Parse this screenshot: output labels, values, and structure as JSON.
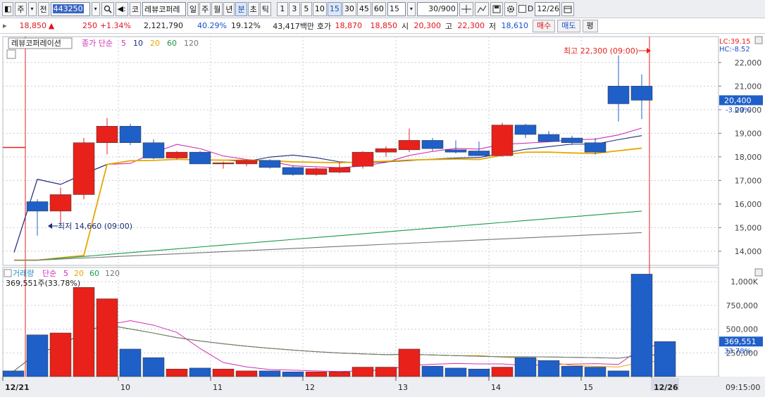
{
  "toolbar": {
    "btn_home": "◧",
    "mkt": "주",
    "mkt_arrow": "▾",
    "prev": "전",
    "code": "443250",
    "search": "🔍",
    "sound": "◀:",
    "name_prefix": "코",
    "name": "레뷰코퍼레",
    "periods": [
      "일",
      "주",
      "월",
      "년",
      "분",
      "초",
      "틱"
    ],
    "active_period": "분",
    "intervals": [
      "1",
      "3",
      "5",
      "10",
      "15",
      "30",
      "45",
      "60"
    ],
    "active_interval": "15",
    "interval_value": "15",
    "count": "30/900",
    "date": "12/26",
    "chk_label": "D"
  },
  "info": {
    "price": "18,850",
    "change_arrow": "▲",
    "change": "250",
    "change_pct": "+1.34%",
    "volume": "2,121,790",
    "vol_ratio": "40.29%",
    "turnover": "19.12%",
    "amount": "43,417백만",
    "ask_label": "호가",
    "ask1": "18,870",
    "bid1": "18,850",
    "open_label": "시",
    "open": "20,300",
    "high_label": "고",
    "high": "22,300",
    "low_label": "저",
    "low": "18,610",
    "buy": "매수",
    "sell": "매도",
    "eval": "평"
  },
  "price_panel": {
    "tab_name": "레뷰코퍼레이션",
    "legend_prefix": "종가 단순",
    "ma_periods": [
      "5",
      "10",
      "20",
      "60",
      "120"
    ],
    "lc": "LC:39.15",
    "hc": "HC:-8.52",
    "current_price": "20,400",
    "current_pct": "-3.09%",
    "hi_note": "최고 22,300 (09:00)",
    "lo_note": "최저 14,660 (09:00)",
    "axis": [
      "22,000",
      "21,000",
      "20,000",
      "19,000",
      "18,000",
      "17,000",
      "16,000",
      "15,000",
      "14,000"
    ]
  },
  "volume_panel": {
    "legend_prefix": "거래량",
    "legend_mid": "단순",
    "ma_periods": [
      "5",
      "20",
      "60",
      "120"
    ],
    "status": "369,551주(33.78%)",
    "current": "369,551",
    "current_pct": "33.78%",
    "axis": [
      "1,000K",
      "750,000",
      "500,000",
      "250,000"
    ]
  },
  "x_axis": [
    "12/21",
    "10",
    "11",
    "12",
    "13",
    "14",
    "15",
    "12/26"
  ],
  "time": "09:15:00",
  "colors": {
    "up": "#e8211b",
    "down": "#1f5fc8",
    "ma5": "#d12fb5",
    "ma10": "#1a2f7a",
    "ma20": "#e6a800",
    "ma60": "#199945",
    "ma120": "#777777"
  },
  "chart_data": {
    "type": "candlestick",
    "ylim": [
      13400,
      22800
    ],
    "candles": [
      {
        "o": 18400,
        "h": 18400,
        "l": 18400,
        "c": 18400
      },
      {
        "o": 16100,
        "h": 16200,
        "l": 14660,
        "c": 15700
      },
      {
        "o": 15700,
        "h": 16700,
        "l": 15200,
        "c": 16400
      },
      {
        "o": 16400,
        "h": 18800,
        "l": 16200,
        "c": 18600
      },
      {
        "o": 18600,
        "h": 19650,
        "l": 18100,
        "c": 19300
      },
      {
        "o": 19300,
        "h": 19400,
        "l": 18500,
        "c": 18600
      },
      {
        "o": 18600,
        "h": 18750,
        "l": 17900,
        "c": 17950
      },
      {
        "o": 17950,
        "h": 18250,
        "l": 17900,
        "c": 18200
      },
      {
        "o": 18200,
        "h": 18250,
        "l": 17700,
        "c": 17700
      },
      {
        "o": 17700,
        "h": 17800,
        "l": 17500,
        "c": 17750
      },
      {
        "o": 17700,
        "h": 17900,
        "l": 17600,
        "c": 17850
      },
      {
        "o": 17850,
        "h": 17900,
        "l": 17500,
        "c": 17550
      },
      {
        "o": 17550,
        "h": 17650,
        "l": 17200,
        "c": 17250
      },
      {
        "o": 17250,
        "h": 17550,
        "l": 17200,
        "c": 17500
      },
      {
        "o": 17350,
        "h": 17800,
        "l": 17300,
        "c": 17550
      },
      {
        "o": 17600,
        "h": 18250,
        "l": 17500,
        "c": 18200
      },
      {
        "o": 18200,
        "h": 18450,
        "l": 18000,
        "c": 18350
      },
      {
        "o": 18300,
        "h": 19200,
        "l": 18200,
        "c": 18700
      },
      {
        "o": 18700,
        "h": 18800,
        "l": 18250,
        "c": 18350
      },
      {
        "o": 18300,
        "h": 18700,
        "l": 18150,
        "c": 18200
      },
      {
        "o": 18250,
        "h": 18650,
        "l": 18050,
        "c": 18050
      },
      {
        "o": 18050,
        "h": 19450,
        "l": 18000,
        "c": 19350
      },
      {
        "o": 19350,
        "h": 19400,
        "l": 18800,
        "c": 18950
      },
      {
        "o": 18950,
        "h": 19100,
        "l": 18650,
        "c": 18650
      },
      {
        "o": 18800,
        "h": 18900,
        "l": 18500,
        "c": 18600
      },
      {
        "o": 18600,
        "h": 18800,
        "l": 18100,
        "c": 18200
      },
      {
        "o": 21000,
        "h": 22300,
        "l": 19500,
        "c": 20250
      },
      {
        "o": 21000,
        "h": 21500,
        "l": 19600,
        "c": 20400
      }
    ],
    "volume": [
      60000,
      440000,
      460000,
      940000,
      820000,
      290000,
      200000,
      80000,
      90000,
      80000,
      60000,
      60000,
      50000,
      50000,
      50000,
      100000,
      100000,
      290000,
      110000,
      90000,
      80000,
      100000,
      200000,
      170000,
      110000,
      100000,
      60000,
      1080000,
      369551
    ],
    "vol_ylim": [
      0,
      1150000
    ]
  }
}
